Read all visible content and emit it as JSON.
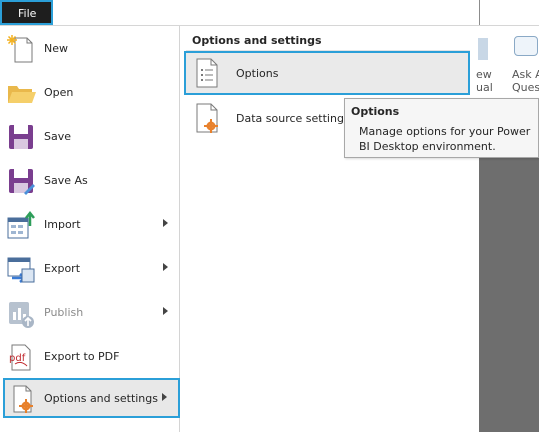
{
  "topbar": {
    "file_label": "File"
  },
  "ribbon": {
    "label_view": "ew\nual",
    "label_ask": "Ask A\nQuestio"
  },
  "left_menu": {
    "items": [
      {
        "label": "New",
        "icon": "new-file-icon",
        "has_submenu": false
      },
      {
        "label": "Open",
        "icon": "folder-icon",
        "has_submenu": false
      },
      {
        "label": "Save",
        "icon": "save-icon",
        "has_submenu": false
      },
      {
        "label": "Save As",
        "icon": "save-as-icon",
        "has_submenu": false
      },
      {
        "label": "Import",
        "icon": "import-icon",
        "has_submenu": true
      },
      {
        "label": "Export",
        "icon": "export-icon",
        "has_submenu": true
      },
      {
        "label": "Publish",
        "icon": "publish-icon",
        "has_submenu": true,
        "disabled": true
      },
      {
        "label": "Export to PDF",
        "icon": "pdf-icon",
        "has_submenu": false
      },
      {
        "label": "Options and settings",
        "icon": "options-settings-icon",
        "has_submenu": true,
        "selected": true
      }
    ]
  },
  "submenu": {
    "header": "Options and settings",
    "items": [
      {
        "label": "Options",
        "icon": "options-list-icon",
        "selected": true
      },
      {
        "label": "Data source settings",
        "icon": "data-source-settings-icon"
      }
    ]
  },
  "tooltip": {
    "title": "Options",
    "body": "Manage options for your Power BI Desktop environment."
  },
  "colors": {
    "accent": "#2b9fd8",
    "file_tab_bg": "#1e1e1e",
    "canvas": "#6e6e6e",
    "gear": "#e8812c"
  }
}
